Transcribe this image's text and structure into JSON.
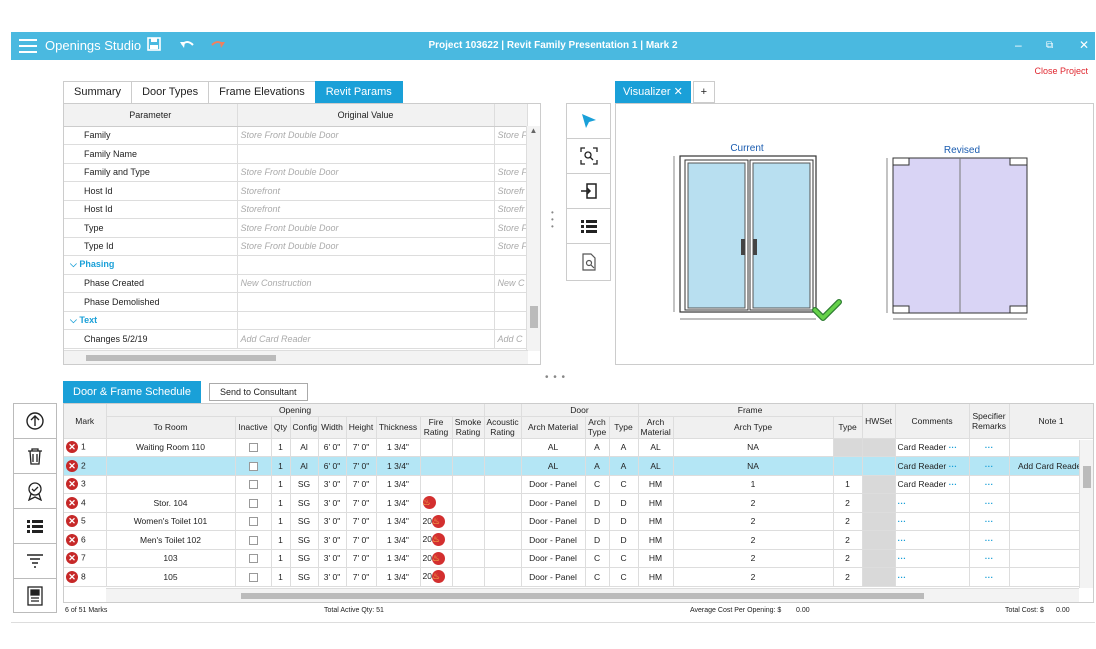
{
  "app": {
    "name": "Openings Studio",
    "project_title": "Project 103622 | Revit Family Presentation 1 | Mark 2",
    "close_project": "Close Project"
  },
  "tabs": [
    "Summary",
    "Door Types",
    "Frame Elevations",
    "Revit Params"
  ],
  "params": {
    "headers": [
      "Parameter",
      "Original Value"
    ],
    "rows": [
      {
        "p": "Family",
        "v": "Store Front Double Door",
        "x": "Store F"
      },
      {
        "p": "Family Name",
        "v": "",
        "x": ""
      },
      {
        "p": "Family and Type",
        "v": "Store Front Double Door",
        "x": "Store F"
      },
      {
        "p": "Host Id",
        "v": "Storefront",
        "x": "Storefr"
      },
      {
        "p": "Host Id",
        "v": "Storefront",
        "x": "Storefr"
      },
      {
        "p": "Type",
        "v": "Store Front Double Door",
        "x": "Store F"
      },
      {
        "p": "Type Id",
        "v": "Store Front Double Door",
        "x": "Store F"
      },
      {
        "section": "Phasing"
      },
      {
        "p": "Phase Created",
        "v": "New Construction",
        "x": "New C"
      },
      {
        "p": "Phase Demolished",
        "v": "",
        "x": ""
      },
      {
        "section": "Text"
      },
      {
        "p": "Changes 5/2/19",
        "v": "Add Card Reader",
        "x": "Add C"
      }
    ]
  },
  "visualizer": {
    "tab": "Visualizer",
    "current": "Current",
    "revised": "Revised"
  },
  "schedule": {
    "tab": "Door & Frame Schedule",
    "send": "Send to Consultant",
    "group_headers": {
      "opening": "Opening",
      "door": "Door",
      "frame": "Frame"
    },
    "columns": {
      "mark": "Mark",
      "to_room": "To Room",
      "inactive": "Inactive",
      "qty": "Qty",
      "config": "Config",
      "width": "Width",
      "height": "Height",
      "thickness": "Thickness",
      "fire": "Fire Rating",
      "smoke": "Smoke Rating",
      "acoustic": "Acoustic Rating",
      "door_mat": "Arch Material",
      "door_archtype": "Arch Type",
      "door_type": "Type",
      "frame_mat": "Arch Material",
      "frame_archtype": "Arch Type",
      "frame_type": "Type",
      "hwset": "HWSet",
      "comments": "Comments",
      "specifier": "Specifier Remarks",
      "note1": "Note 1"
    },
    "rows": [
      {
        "mark": "1",
        "room": "Waiting Room 110",
        "qty": "1",
        "config": "Al",
        "w": "6' 0\"",
        "h": "7' 0\"",
        "t": "1 3/4\"",
        "fire": "",
        "dmat": "AL",
        "dat": "A",
        "dt": "A",
        "fmat": "AL",
        "fat": "NA",
        "ft": "",
        "comments": "Card Reader",
        "note": "",
        "sel": false,
        "fireicon": false
      },
      {
        "mark": "2",
        "room": "",
        "qty": "1",
        "config": "Al",
        "w": "6' 0\"",
        "h": "7' 0\"",
        "t": "1 3/4\"",
        "fire": "",
        "dmat": "AL",
        "dat": "A",
        "dt": "A",
        "fmat": "AL",
        "fat": "NA",
        "ft": "",
        "comments": "Card Reader",
        "note": "Add Card Reader",
        "sel": true,
        "fireicon": false
      },
      {
        "mark": "3",
        "room": "",
        "qty": "1",
        "config": "SG",
        "w": "3' 0\"",
        "h": "7' 0\"",
        "t": "1 3/4\"",
        "fire": "",
        "dmat": "Door - Panel",
        "dat": "C",
        "dt": "C",
        "fmat": "HM",
        "fat": "1",
        "ft": "1",
        "comments": "Card Reader",
        "note": "",
        "sel": false,
        "fireicon": false
      },
      {
        "mark": "4",
        "room": "Stor. 104",
        "qty": "1",
        "config": "SG",
        "w": "3' 0\"",
        "h": "7' 0\"",
        "t": "1 3/4\"",
        "fire": "",
        "dmat": "Door - Panel",
        "dat": "D",
        "dt": "D",
        "fmat": "HM",
        "fat": "2",
        "ft": "2",
        "comments": "",
        "note": "",
        "sel": false,
        "fireicon": true
      },
      {
        "mark": "5",
        "room": "Women's Toilet 101",
        "qty": "1",
        "config": "SG",
        "w": "3' 0\"",
        "h": "7' 0\"",
        "t": "1 3/4\"",
        "fire": "20",
        "dmat": "Door - Panel",
        "dat": "D",
        "dt": "D",
        "fmat": "HM",
        "fat": "2",
        "ft": "2",
        "comments": "",
        "note": "",
        "sel": false,
        "fireicon": true
      },
      {
        "mark": "6",
        "room": "Men's Toilet 102",
        "qty": "1",
        "config": "SG",
        "w": "3' 0\"",
        "h": "7' 0\"",
        "t": "1 3/4\"",
        "fire": "20",
        "dmat": "Door - Panel",
        "dat": "D",
        "dt": "D",
        "fmat": "HM",
        "fat": "2",
        "ft": "2",
        "comments": "",
        "note": "",
        "sel": false,
        "fireicon": true
      },
      {
        "mark": "7",
        "room": "103",
        "qty": "1",
        "config": "SG",
        "w": "3' 0\"",
        "h": "7' 0\"",
        "t": "1 3/4\"",
        "fire": "20",
        "dmat": "Door - Panel",
        "dat": "C",
        "dt": "C",
        "fmat": "HM",
        "fat": "2",
        "ft": "2",
        "comments": "",
        "note": "",
        "sel": false,
        "fireicon": true
      },
      {
        "mark": "8",
        "room": "105",
        "qty": "1",
        "config": "SG",
        "w": "3' 0\"",
        "h": "7' 0\"",
        "t": "1 3/4\"",
        "fire": "20",
        "dmat": "Door - Panel",
        "dat": "C",
        "dt": "C",
        "fmat": "HM",
        "fat": "2",
        "ft": "2",
        "comments": "",
        "note": "",
        "sel": false,
        "fireicon": true
      }
    ]
  },
  "footer": {
    "marks": "6 of 51 Marks",
    "qty": "Total Active Qty: 51",
    "avg": "Average Cost Per Opening: $",
    "avg_val": "0.00",
    "total": "Total Cost: $",
    "total_val": "0.00"
  },
  "colors": {
    "accent": "#4ab9e0",
    "tab_active": "#1aa0d8",
    "selected_row": "#b4e6f5",
    "error": "#c62828"
  }
}
